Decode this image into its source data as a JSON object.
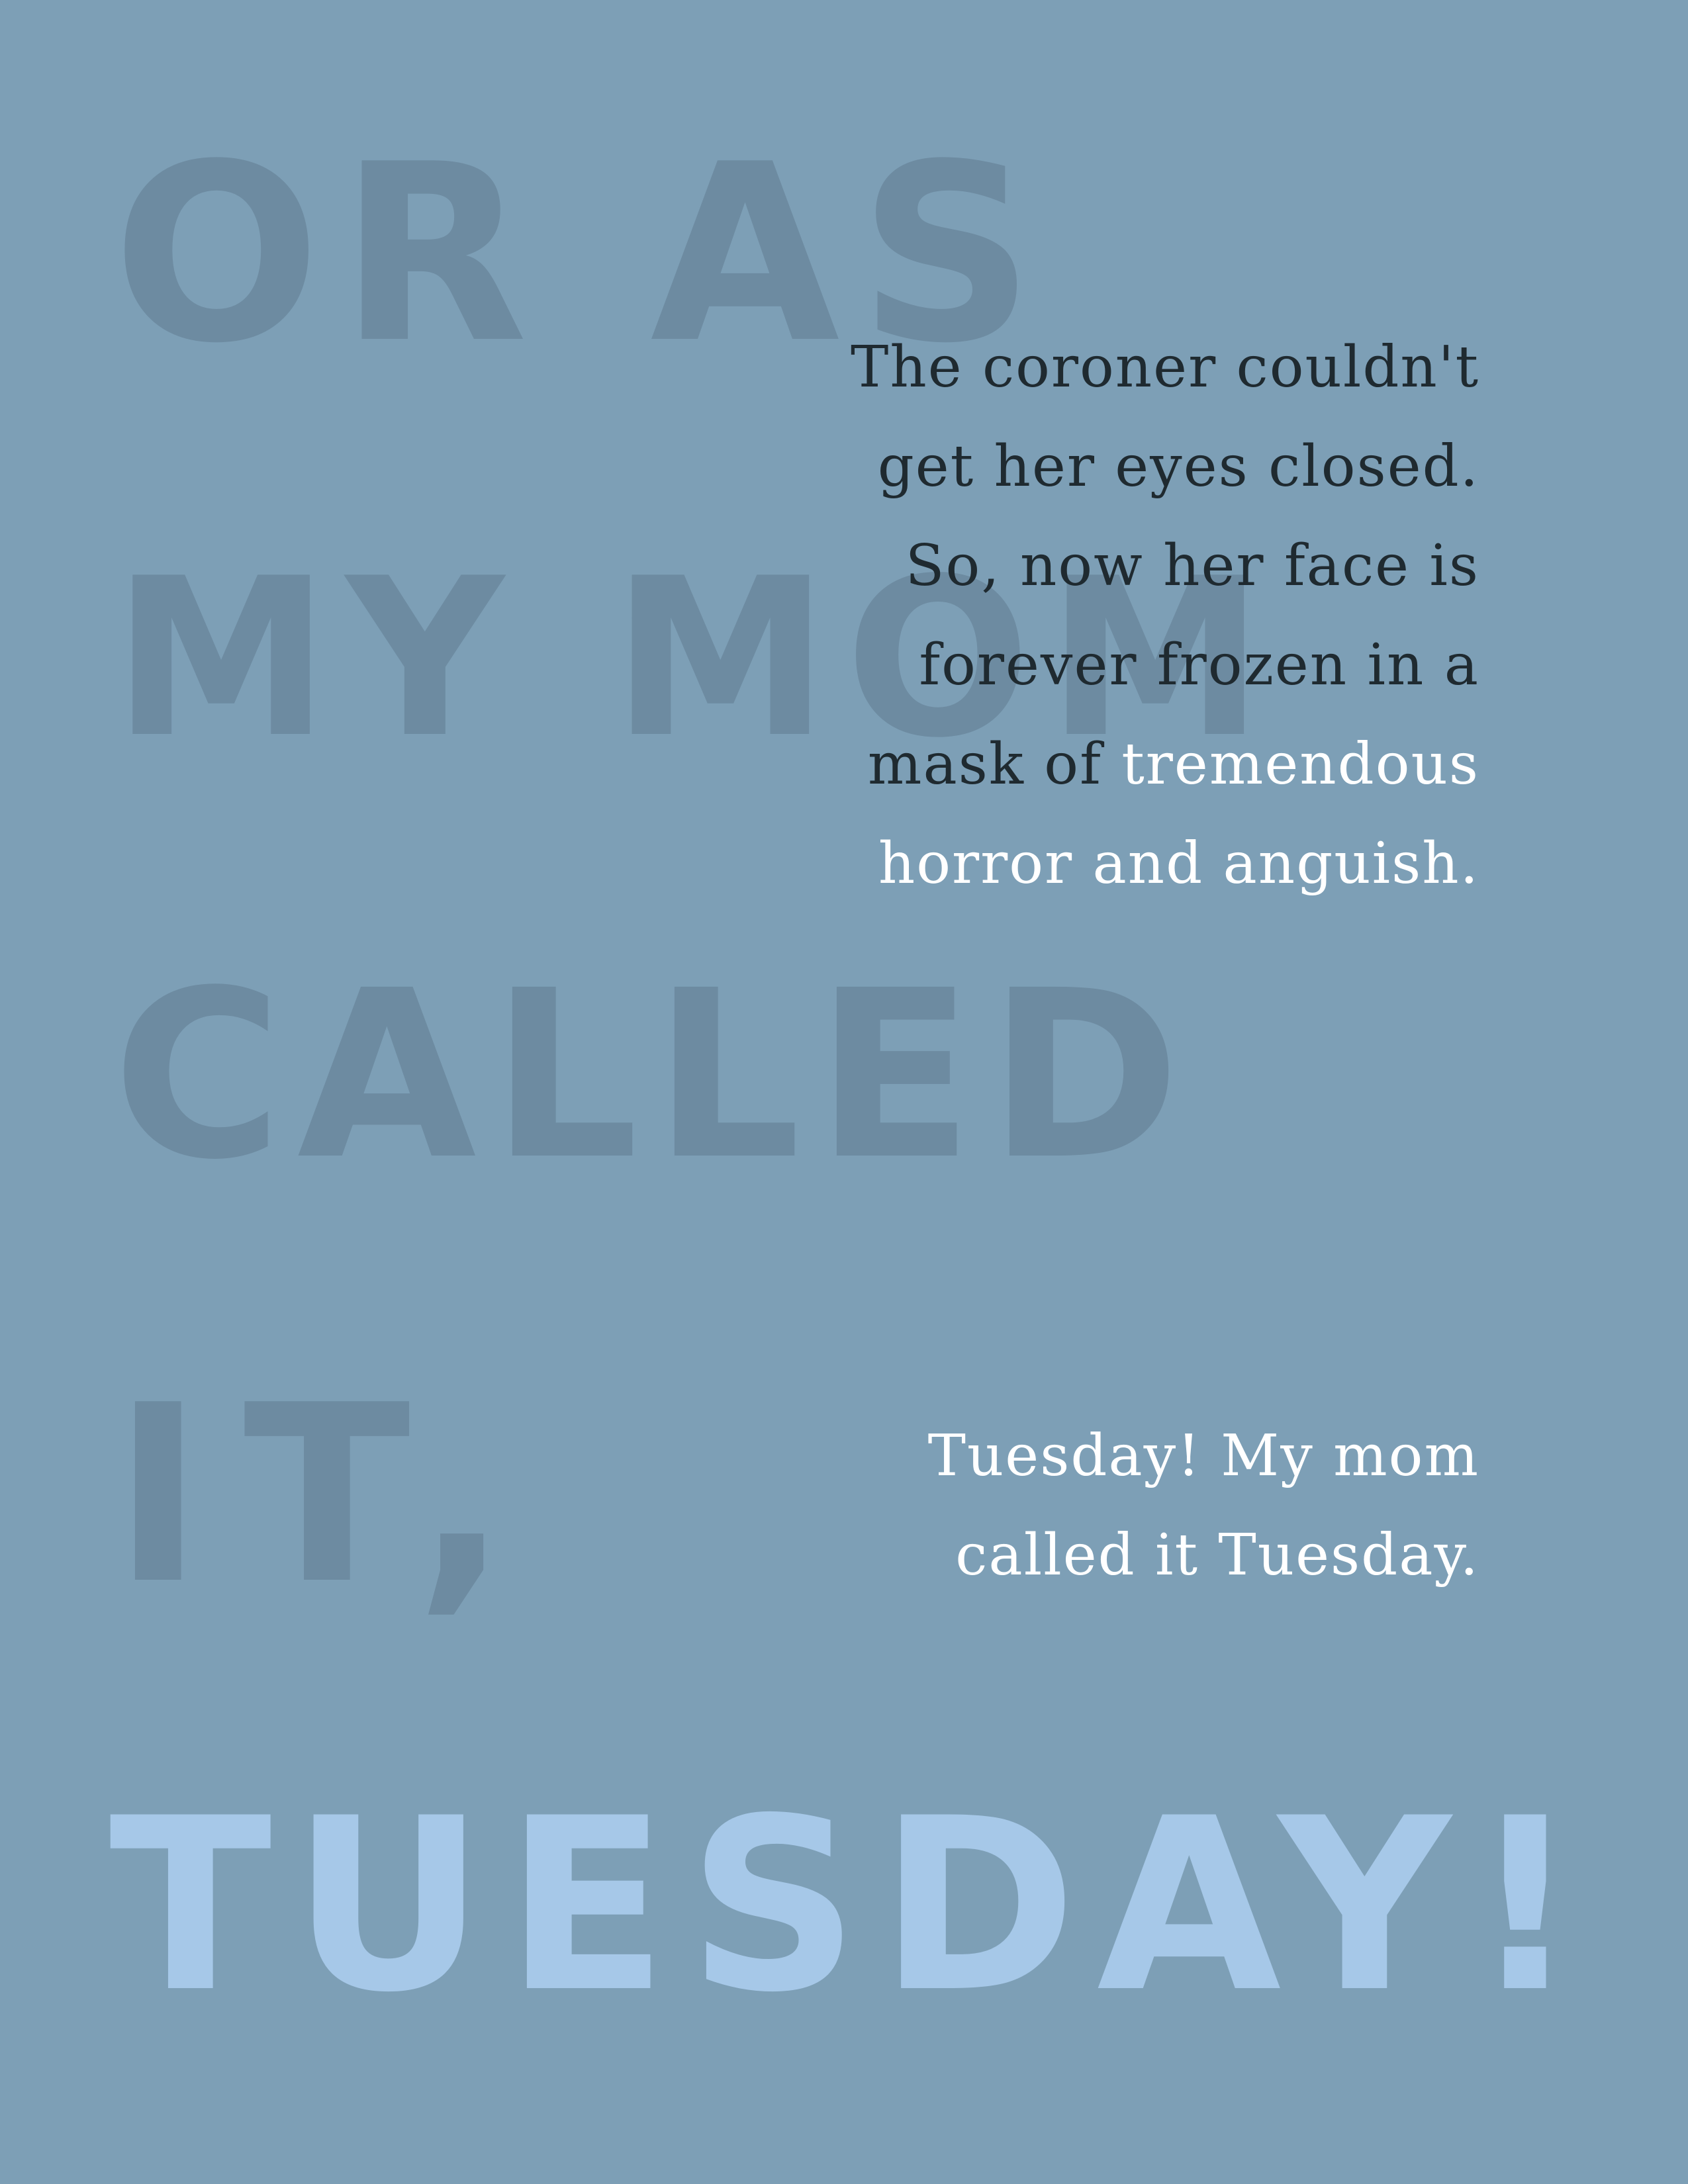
{
  "background_color": "#7d9fb6",
  "accent_color": "#a6c8e8",
  "display": {
    "line1": "OR AS",
    "line2": "MY MOM",
    "line3": "CALLED",
    "line4": "IT,",
    "line5": "TUESDAY!"
  },
  "quote1": {
    "l1": "The coroner couldn't",
    "l2": "get her eyes closed.",
    "l3": "So, now her face is",
    "l4": "forever frozen in a",
    "l5a": "mask of ",
    "l5b": "tremendous",
    "l6": "horror and anguish."
  },
  "quote2": {
    "l1": "Tuesday! My mom",
    "l2": "called it Tuesday."
  }
}
